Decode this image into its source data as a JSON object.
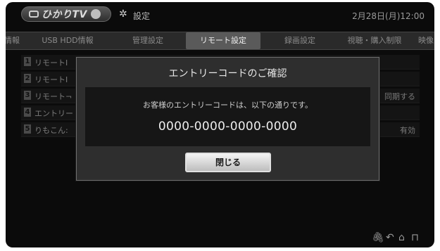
{
  "header": {
    "logo_text": "ひかりTV",
    "settings_title": "設定",
    "datetime": "2月28日(月)12:00"
  },
  "tabs": [
    {
      "label": "情報"
    },
    {
      "label": "USB HDD情報"
    },
    {
      "label": "管理設定"
    },
    {
      "label": "リモート設定",
      "active": true
    },
    {
      "label": "録画設定"
    },
    {
      "label": "視聴・購入制限"
    },
    {
      "label": "映像"
    }
  ],
  "settings_list": [
    {
      "number": "1",
      "label": "リモートI",
      "value": ""
    },
    {
      "number": "2",
      "label": "リモートI",
      "value": ""
    },
    {
      "number": "3",
      "label": "リモート¬",
      "value": "同期する"
    },
    {
      "number": "4",
      "label": "エントリー",
      "value": ""
    },
    {
      "number": "5",
      "label": "りもこん:",
      "value": "有効"
    }
  ],
  "dialog": {
    "title": "エントリーコードのご確認",
    "message": "お客様のエントリーコードは、以下の通りです。",
    "code": "0000-0000-0000-0000",
    "close_label": "閉じる"
  },
  "icons": [
    "gear-icon",
    "attachment-icon",
    "back-icon",
    "home-icon",
    "lock-icon"
  ]
}
